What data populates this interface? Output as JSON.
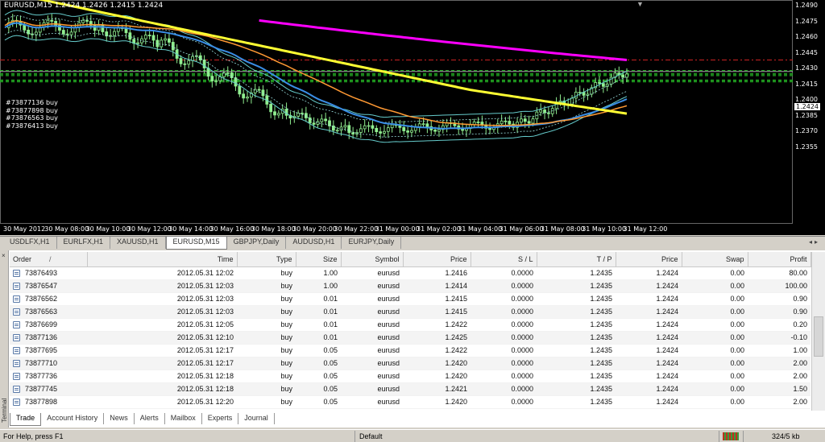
{
  "chart": {
    "title": "EURUSD,M15  1.2424 1.2426 1.2415 1.2424",
    "current_price": "1.2424",
    "price_ticks": [
      "1.2490",
      "1.2475",
      "1.2460",
      "1.2445",
      "1.2430",
      "1.2415",
      "1.2400",
      "1.2385",
      "1.2370",
      "1.2355"
    ],
    "time_ticks": [
      "30 May 2012",
      "30 May 08:00",
      "30 May 10:00",
      "30 May 12:00",
      "30 May 14:00",
      "30 May 16:00",
      "30 May 18:00",
      "30 May 20:00",
      "30 May 22:00",
      "31 May 00:00",
      "31 May 02:00",
      "31 May 04:00",
      "31 May 06:00",
      "31 May 08:00",
      "31 May 10:00",
      "31 May 12:00"
    ],
    "position_labels": [
      "#73877136 buy",
      "#73877898 buy",
      "#73876563 buy",
      "#73876413 buy"
    ],
    "colors": {
      "bg": "#000000",
      "candle": "#90ee90",
      "ma_fast": "#3a8ee6",
      "ma_mid": "#ff9933",
      "ma_slow": "#ffff33",
      "ma_long": "#ff00ff",
      "band": "#66cccc",
      "order_line": "#22aa22",
      "tp_line": "#cc2222"
    }
  },
  "chart_tabs": [
    {
      "label": "USDLFX,H1",
      "active": false
    },
    {
      "label": "EURLFX,H1",
      "active": false
    },
    {
      "label": "XAUUSD,H1",
      "active": false
    },
    {
      "label": "EURUSD,M15",
      "active": true
    },
    {
      "label": "GBPJPY,Daily",
      "active": false
    },
    {
      "label": "AUDUSD,H1",
      "active": false
    },
    {
      "label": "EURJPY,Daily",
      "active": false
    }
  ],
  "terminal": {
    "side_label": "Terminal",
    "close_glyph": "×",
    "columns": [
      "Order",
      "Time",
      "Type",
      "Size",
      "Symbol",
      "Price",
      "S / L",
      "T / P",
      "Price",
      "Swap",
      "Profit"
    ],
    "sort_indicator": "/",
    "rows": [
      [
        "73876493",
        "2012.05.31 12:02",
        "buy",
        "1.00",
        "eurusd",
        "1.2416",
        "0.0000",
        "1.2435",
        "1.2424",
        "0.00",
        "80.00"
      ],
      [
        "73876547",
        "2012.05.31 12:03",
        "buy",
        "1.00",
        "eurusd",
        "1.2414",
        "0.0000",
        "1.2435",
        "1.2424",
        "0.00",
        "100.00"
      ],
      [
        "73876562",
        "2012.05.31 12:03",
        "buy",
        "0.01",
        "eurusd",
        "1.2415",
        "0.0000",
        "1.2435",
        "1.2424",
        "0.00",
        "0.90"
      ],
      [
        "73876563",
        "2012.05.31 12:03",
        "buy",
        "0.01",
        "eurusd",
        "1.2415",
        "0.0000",
        "1.2435",
        "1.2424",
        "0.00",
        "0.90"
      ],
      [
        "73876699",
        "2012.05.31 12:05",
        "buy",
        "0.01",
        "eurusd",
        "1.2422",
        "0.0000",
        "1.2435",
        "1.2424",
        "0.00",
        "0.20"
      ],
      [
        "73877136",
        "2012.05.31 12:10",
        "buy",
        "0.01",
        "eurusd",
        "1.2425",
        "0.0000",
        "1.2435",
        "1.2424",
        "0.00",
        "-0.10"
      ],
      [
        "73877695",
        "2012.05.31 12:17",
        "buy",
        "0.05",
        "eurusd",
        "1.2422",
        "0.0000",
        "1.2435",
        "1.2424",
        "0.00",
        "1.00"
      ],
      [
        "73877710",
        "2012.05.31 12:17",
        "buy",
        "0.05",
        "eurusd",
        "1.2420",
        "0.0000",
        "1.2435",
        "1.2424",
        "0.00",
        "2.00"
      ],
      [
        "73877736",
        "2012.05.31 12:18",
        "buy",
        "0.05",
        "eurusd",
        "1.2420",
        "0.0000",
        "1.2435",
        "1.2424",
        "0.00",
        "2.00"
      ],
      [
        "73877745",
        "2012.05.31 12:18",
        "buy",
        "0.05",
        "eurusd",
        "1.2421",
        "0.0000",
        "1.2435",
        "1.2424",
        "0.00",
        "1.50"
      ],
      [
        "73877898",
        "2012.05.31 12:20",
        "buy",
        "0.05",
        "eurusd",
        "1.2420",
        "0.0000",
        "1.2435",
        "1.2424",
        "0.00",
        "2.00"
      ]
    ],
    "tabs": [
      {
        "label": "Trade",
        "active": true
      },
      {
        "label": "Account History",
        "active": false
      },
      {
        "label": "News",
        "active": false
      },
      {
        "label": "Alerts",
        "active": false
      },
      {
        "label": "Mailbox",
        "active": false
      },
      {
        "label": "Experts",
        "active": false
      },
      {
        "label": "Journal",
        "active": false
      }
    ]
  },
  "statusbar": {
    "help": "For Help, press F1",
    "profile": "Default",
    "traffic": "324/5 kb"
  }
}
